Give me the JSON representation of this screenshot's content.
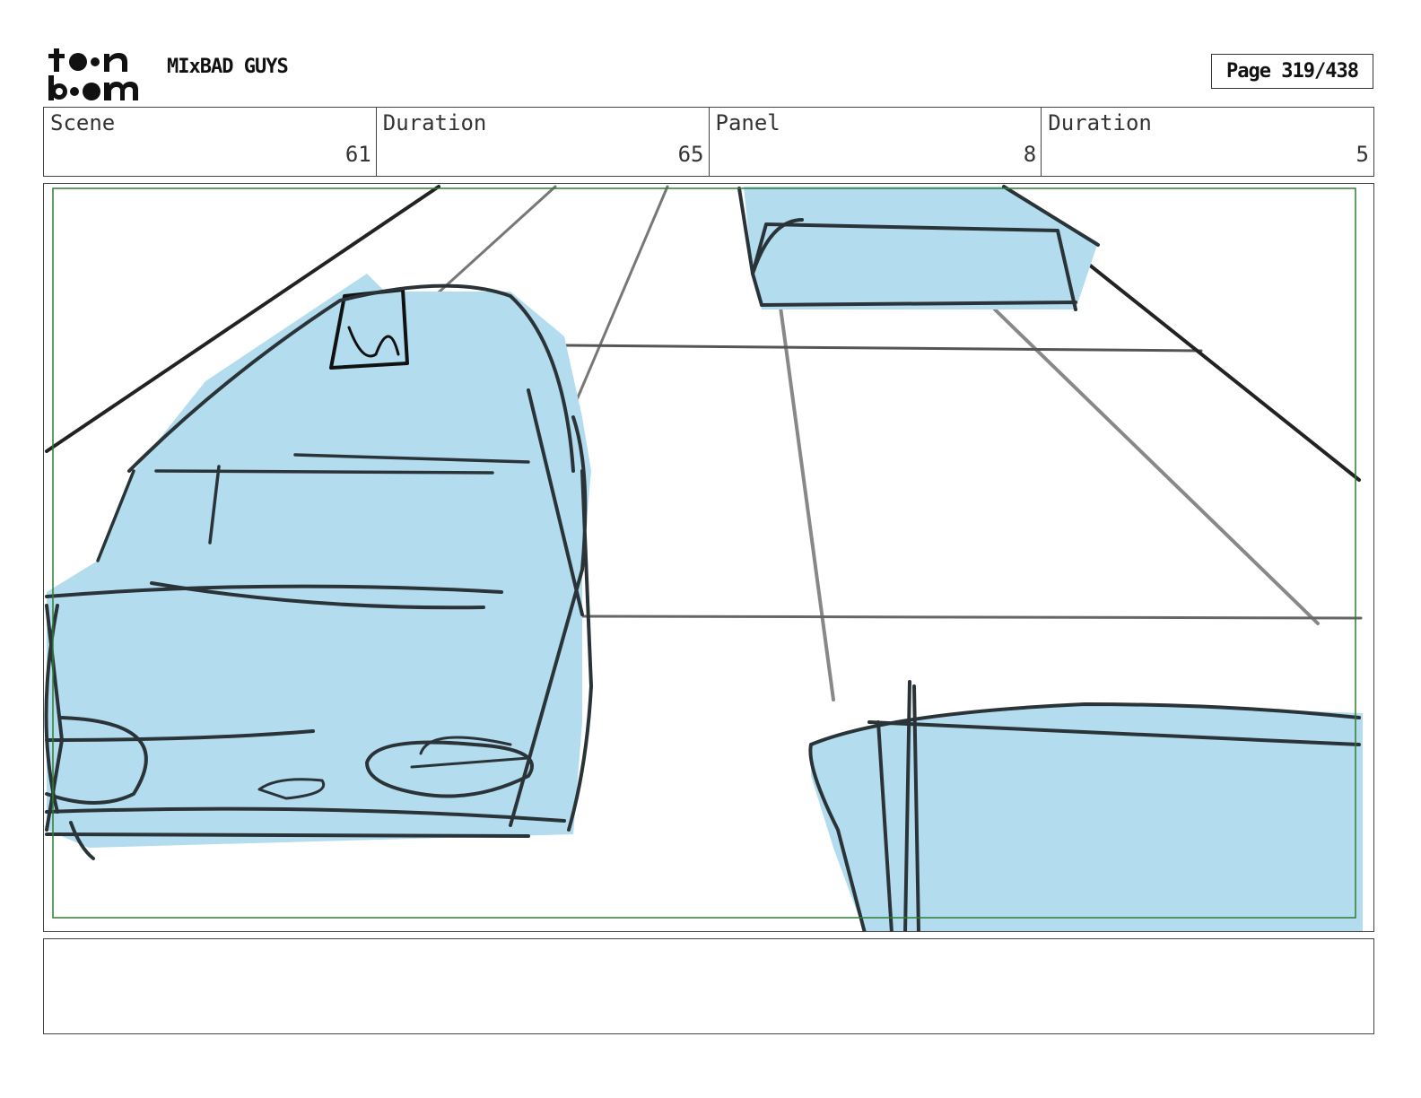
{
  "header": {
    "logo_icon": "toon-boom-logo",
    "logo_text_top": "toon",
    "logo_text_bottom": "boom",
    "project_title": "MIxBAD GUYS",
    "page_label": "Page 319/438"
  },
  "info": {
    "scene_label": "Scene",
    "scene_value": "61",
    "scene_duration_label": "Duration",
    "scene_duration_value": "65",
    "panel_label": "Panel",
    "panel_value": "8",
    "panel_duration_label": "Duration",
    "panel_duration_value": "5"
  },
  "panel": {
    "image_icon": "storyboard-sketch-cars-on-road",
    "fill_color": "#b3dcef",
    "line_color": "#2a3438",
    "safe_frame_color": "#2e7d32"
  },
  "notes": {
    "text": ""
  }
}
